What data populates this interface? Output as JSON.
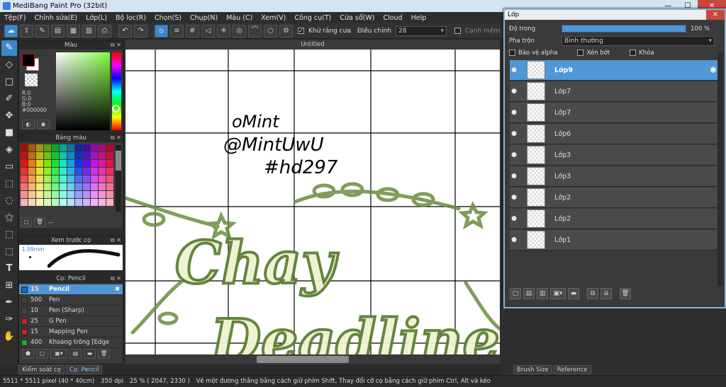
{
  "window": {
    "title": "MediBang Paint Pro (32bit)"
  },
  "menu": [
    "Tệp(F)",
    "Chỉnh sửa(E)",
    "Lớp(L)",
    "Bộ lọc(R)",
    "Chọn(S)",
    "Chụp(N)",
    "Màu (C)",
    "Xem(V)",
    "Công cụ(T)",
    "Cửa sổ(W)",
    "Cloud",
    "Help"
  ],
  "toolbar": {
    "antialias_label": "Khử răng cưa",
    "adjust_label": "Điều chỉnh",
    "adjust_value": "28",
    "sharp_edge_label": "Cạnh mềm"
  },
  "color_panel": {
    "title": "Màu",
    "r": "R:0",
    "g": "G:0",
    "b": "B:0",
    "hex": "#000000",
    "primary_color": "#000000",
    "secondary_color": "#ffffff"
  },
  "palette_panel": {
    "title": "Bảng màu",
    "bottom_label": "---"
  },
  "brush_preview": {
    "title": "Xem trước cọ",
    "size": "1.09mm"
  },
  "brush_panel": {
    "title": "Cọ: Pencil",
    "brushes": [
      {
        "size": "15",
        "name": "Pencil",
        "color": "#1a6ac0"
      },
      {
        "size": "500",
        "name": "Pen",
        "color": "#444444"
      },
      {
        "size": "10",
        "name": "Pen (Sharp)",
        "color": "#444444"
      },
      {
        "size": "25",
        "name": "G Pen",
        "color": "#cc2222"
      },
      {
        "size": "15",
        "name": "Mapping Pen",
        "color": "#cc2222"
      },
      {
        "size": "400",
        "name": "Khoảng trống [Edge I",
        "color": "#22aa22"
      }
    ]
  },
  "left_tabs": [
    "Kiểm soát cọ",
    "Cọ: Pencil"
  ],
  "document": {
    "title": "Untitled"
  },
  "canvas": {
    "handwriting_1": "oMint",
    "handwriting_2": "@MintUwU",
    "handwriting_3": "#hd297",
    "art_text_1": "Chay",
    "art_text_2": "Deadline"
  },
  "layer_window": {
    "title": "Lớp",
    "opacity_label": "Độ trong",
    "opacity_value": "100 %",
    "opacity_fraction": 1.0,
    "blend_label": "Pha trộn",
    "blend_value": "Bình thường",
    "protect_alpha": "Bảo vệ alpha",
    "clipping": "Xén bớt",
    "lock": "Khóa",
    "layers": [
      "Lớp9",
      "Lớp7",
      "Lớp7",
      "Lớp6",
      "Lớp3",
      "Lớp3",
      "Lớp2",
      "Lớp2",
      "Lớp1"
    ]
  },
  "right_tabs": [
    "Brush Size",
    "Reference"
  ],
  "status": {
    "dims": "5511 * 5511 pixel",
    "physical": "(40 * 40cm)",
    "dpi": "350 dpi",
    "zoom": "25 %",
    "coords": "( 2047, 2330 )",
    "hint": "Vẽ một đường thẳng bằng cách giữ phím Shift, Thay đổi cỡ cọ bằng cách giữ phím Ctrl, Alt và kéo"
  }
}
